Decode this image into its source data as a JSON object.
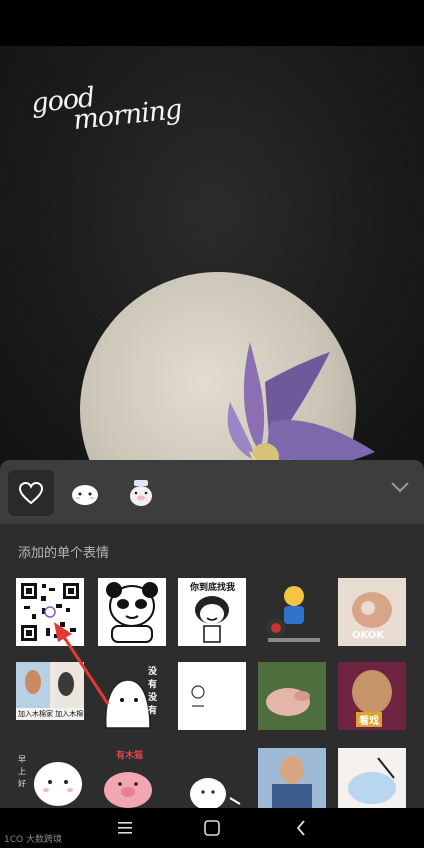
{
  "background": {
    "greeting_line1": "good",
    "greeting_line2": "morning"
  },
  "emoji_panel": {
    "tabs": [
      {
        "name": "favorites",
        "icon": "heart-icon",
        "active": true
      },
      {
        "name": "bear-pack",
        "icon": "bear-icon",
        "active": false
      },
      {
        "name": "pig-pack",
        "icon": "pig-icon",
        "active": false
      }
    ],
    "collapse_icon": "chevron-down-icon",
    "section_title": "添加的单个表情",
    "stickers": [
      {
        "id": "qr",
        "text": ""
      },
      {
        "id": "panda-ok",
        "text": ""
      },
      {
        "id": "panda-find",
        "text": "你到底找我"
      },
      {
        "id": "panda-cartoon",
        "text": ""
      },
      {
        "id": "ok-hand",
        "text": "OKOK"
      },
      {
        "id": "photo-people",
        "text": "加入木棉家 加入木棉妖!"
      },
      {
        "id": "white-blob",
        "text": "没有没有"
      },
      {
        "id": "small-doodle",
        "text": ""
      },
      {
        "id": "pig-meat",
        "text": ""
      },
      {
        "id": "man-sad",
        "text": "看戏"
      },
      {
        "id": "fluffy-cat",
        "text": "早上好"
      },
      {
        "id": "pink-pig",
        "text": "有木猫"
      },
      {
        "id": "round-face",
        "text": ""
      },
      {
        "id": "police-photo",
        "text": ""
      },
      {
        "id": "anime-girl",
        "text": ""
      }
    ]
  },
  "nav_bar": {
    "menu_icon": "menu-icon",
    "home_icon": "home-icon",
    "back_icon": "back-icon"
  },
  "watermark": "1CO 大数跨境",
  "colors": {
    "panel": "#2d2d2d",
    "tab_bar": "#3d3d3d",
    "arrow": "#e53935"
  }
}
